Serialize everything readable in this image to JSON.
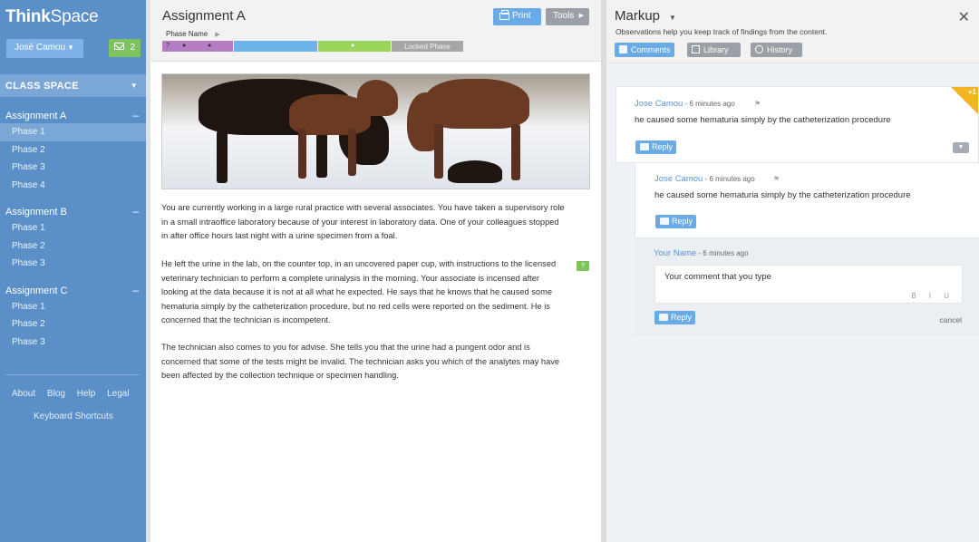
{
  "app": {
    "logo_think": "Think",
    "logo_space": "Space",
    "user_name": "José Camou",
    "message_count": "2",
    "class_space_label": "CLASS SPACE"
  },
  "sidebar": {
    "assignments": [
      {
        "title": "Assignment A",
        "phases": [
          "Phase 1",
          "Phase 2",
          "Phase 3",
          "Phase 4"
        ],
        "active_phase": 0
      },
      {
        "title": "Assignment B",
        "phases": [
          "Phase 1",
          "Phase 2",
          "Phase 3"
        ]
      },
      {
        "title": "Assignment C",
        "phases": [
          "Phase 1",
          "Phase 2",
          "Phase 3"
        ]
      }
    ],
    "footer_links": [
      "About",
      "Blog",
      "Help",
      "Legal"
    ],
    "shortcuts_label": "Keyboard Shortcuts"
  },
  "content": {
    "title": "Assignment A",
    "print_label": "Print",
    "tools_label": "Tools",
    "phase_name_label": "Phase Name",
    "phase_segment_marker": "?",
    "locked_phase_label": "Locked Phase",
    "comment_marker": "?",
    "paragraphs": [
      "You are currently working in a large rural practice with several associates.  You have taken a supervisory role in a small intraoffice laboratory because of your interest in laboratory data.  One of your colleagues stopped in after office hours last night with a urine specimen from a foal.",
      "He left the urine in the lab, on the counter top, in an uncovered paper cup, with instructions to the licensed veterinary technician to perform a complete urinalysis in the morning. Your associate is incensed after looking at the data because it is not at all what he expected.  He says that he knows that he caused some hematuria simply by the catheterization procedure, but no red cells were reported on the sediment.  He is concerned that the technician is incompetent.",
      "The technician also comes to you for advise.  She tells you that the urine had a pungent odor and is concerned that some of the tests might be invalid. The technician asks you which of the analytes may have been affected by the collection technique or specimen handling."
    ]
  },
  "markup": {
    "title": "Markup",
    "subtitle": "Observations help you keep track of findings from the content.",
    "tabs": [
      "Comments",
      "Library",
      "History"
    ],
    "comments": [
      {
        "author": "Jose Camou",
        "time": " - 6 minutes ago",
        "text": "he caused some hematuria simply by the catheterization procedure",
        "reply_label": "Reply",
        "badge": "+1"
      },
      {
        "author": "Jose Camou",
        "time": " - 6 minutes ago",
        "text": "he caused some hematuria simply by the catheterization procedure",
        "reply_label": "Reply"
      }
    ],
    "new_comment": {
      "author": "Your Name",
      "time": " - 6 minutes ago",
      "text": "Your comment that you type",
      "format_buttons": "B I U",
      "reply_label": "Reply",
      "cancel_label": "cancel"
    }
  },
  "colors": {
    "sidebar": "#5b8fc7",
    "accent_blue": "#6aaae6",
    "green": "#7dc45e",
    "phase_purple": "#b57ec2",
    "phase_blue": "#6cb5ea",
    "phase_green": "#99d45b",
    "badge_orange": "#f2b51f"
  }
}
